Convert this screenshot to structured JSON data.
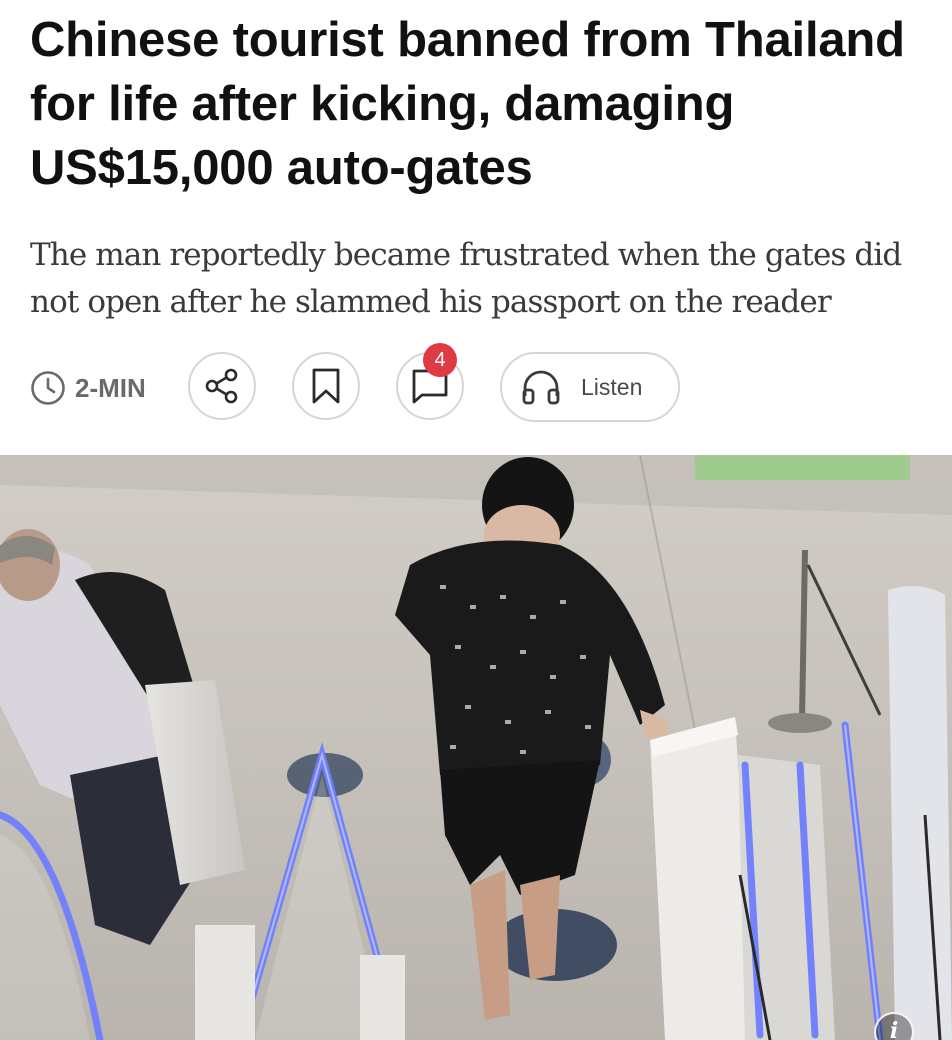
{
  "article": {
    "headline": "Chinese tourist banned from Thailand for life after kicking, damaging US$15,000 auto-gates",
    "standfirst": "The man reportedly became frustrated when the gates did not open after he slammed his passport on the reader"
  },
  "toolbar": {
    "read_time": "2-MIN",
    "comment_count": "4",
    "listen_label": "Listen"
  },
  "image": {
    "info_label": "i"
  },
  "icons": {
    "read_time": "clock-icon",
    "share": "share-icon",
    "bookmark": "bookmark-icon",
    "comments": "comment-icon",
    "listen": "headphones-icon",
    "info": "info-icon"
  },
  "colors": {
    "badge": "#e03a45",
    "gate_light": "#6f7dff"
  }
}
